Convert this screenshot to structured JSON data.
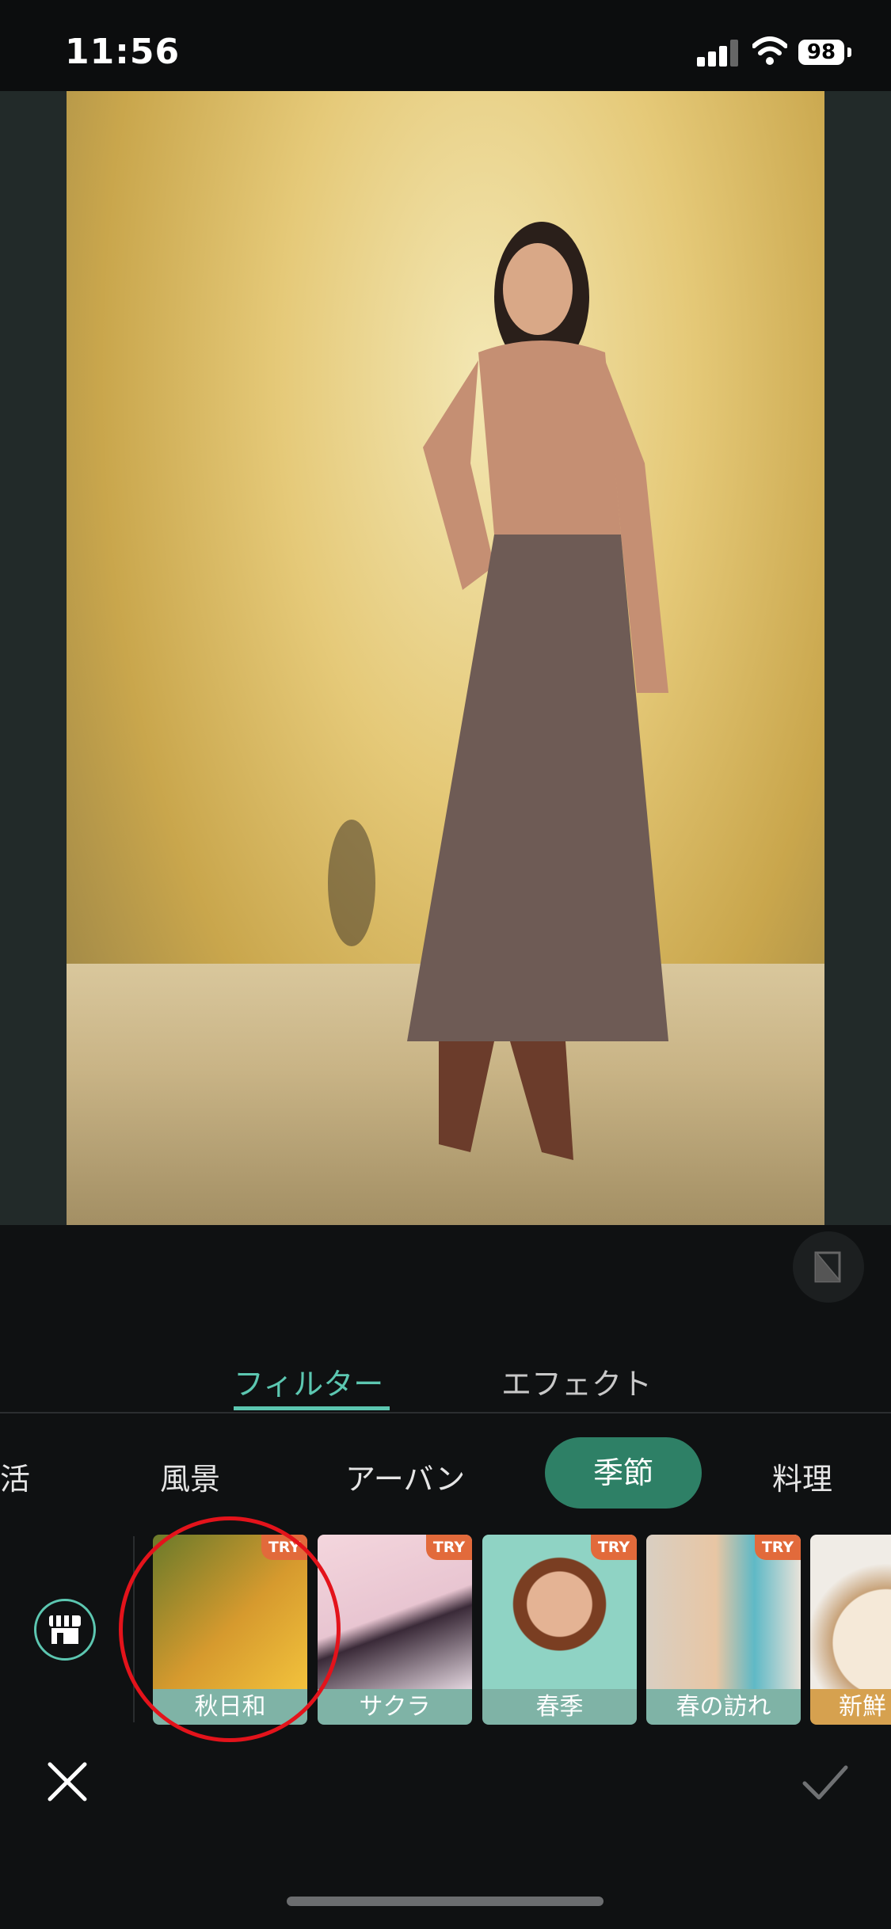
{
  "status_bar": {
    "time": "11:56",
    "battery": "98"
  },
  "tabs": {
    "filter": "フィルター",
    "effect": "エフェクト"
  },
  "categories": {
    "items": [
      "生活",
      "風景",
      "アーバン",
      "季節",
      "料理"
    ],
    "active": "季節"
  },
  "thumbnails": [
    {
      "label": "秋日和",
      "badge": "TRY"
    },
    {
      "label": "サクラ",
      "badge": "TRY"
    },
    {
      "label": "春季",
      "badge": "TRY"
    },
    {
      "label": "春の訪れ",
      "badge": "TRY"
    },
    {
      "label": "新鮮",
      "badge": ""
    }
  ],
  "colors": {
    "accent": "#5cc7b1",
    "active_category": "#2e8066",
    "highlight_circle": "#e3131b",
    "try_badge": "#e26a3b"
  },
  "icons": [
    "shop-icon",
    "close-icon",
    "check-icon",
    "compare-icon",
    "wifi-icon",
    "signal-icon",
    "battery-icon"
  ]
}
